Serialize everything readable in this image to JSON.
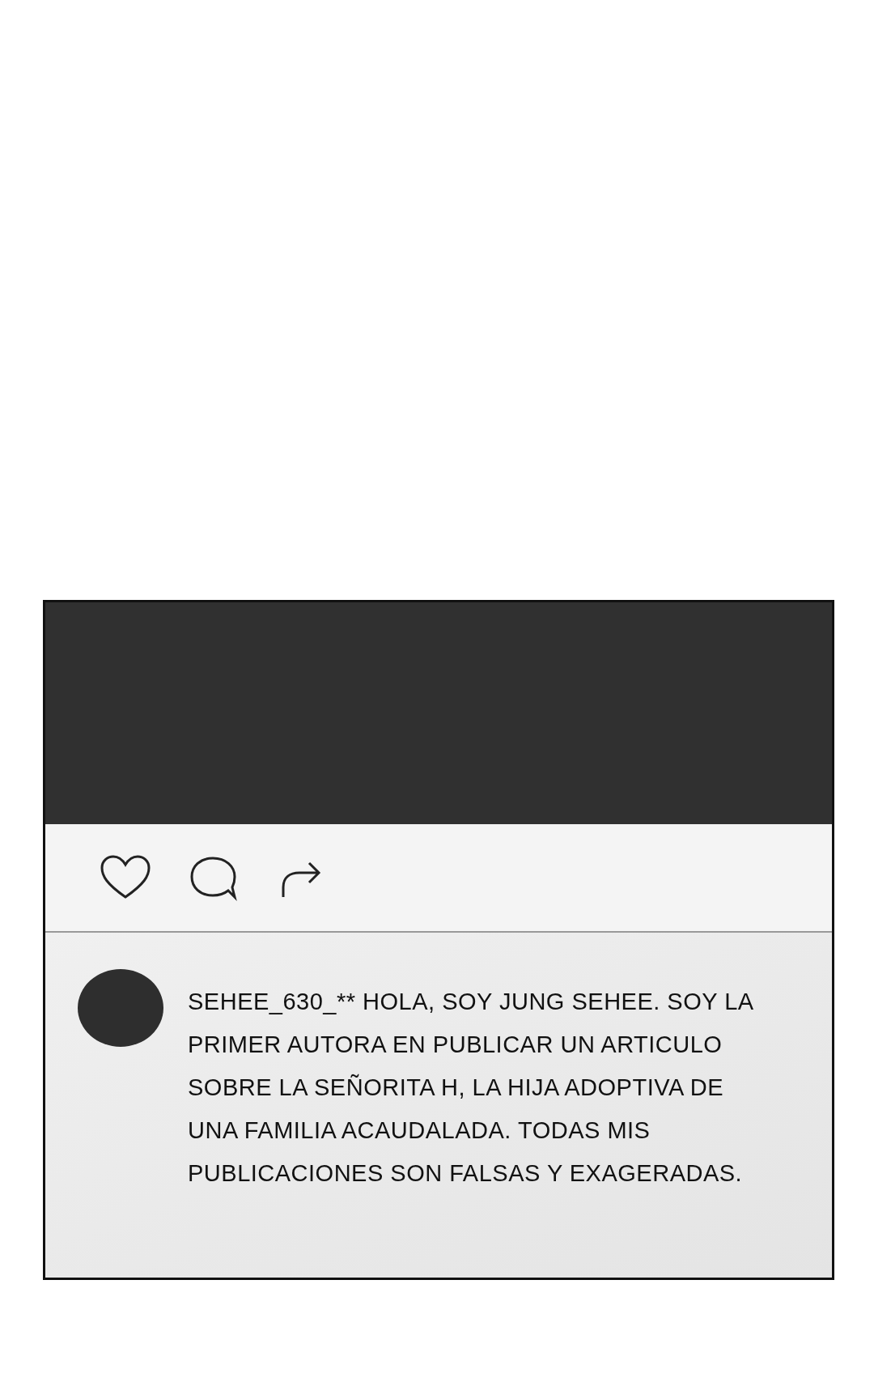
{
  "post": {
    "media": {
      "kind": "dark"
    },
    "actions": [
      {
        "kind": "heart"
      },
      {
        "kind": "bubble"
      },
      {
        "kind": "share"
      }
    ],
    "comment": {
      "text": "SEHEE_630_** HOLA, SOY JUNG SEHEE. SOY LA PRIMER AUTORA EN PUBLICAR UN ARTICULO SOBRE LA SEÑORITA H, LA HIJA ADOPTIVA DE UNA FAMILIA ACAUDALADA. TODAS MIS PUBLICACIONES SON FALSAS Y EXAGERADAS."
    }
  }
}
